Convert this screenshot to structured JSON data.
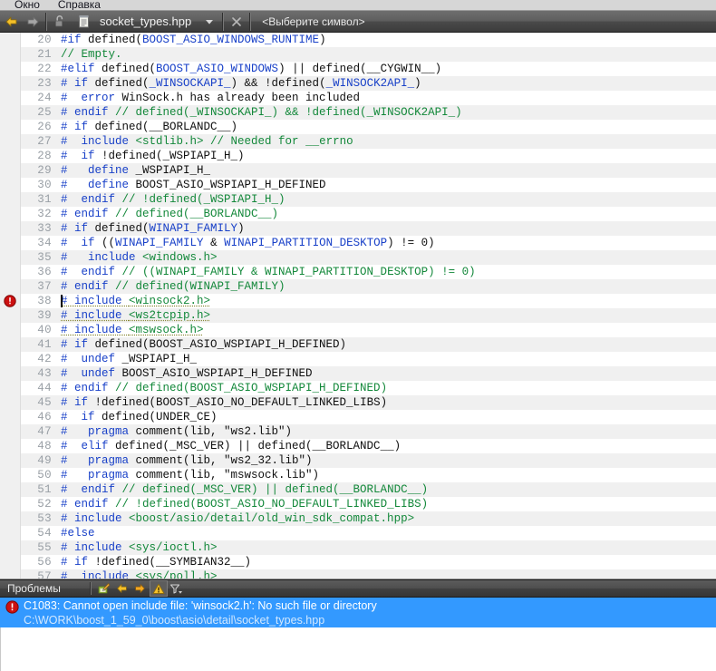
{
  "menubar": {
    "items": [
      {
        "label": "Окно"
      },
      {
        "label": "Справка"
      }
    ]
  },
  "navbar": {
    "back_icon": "back-arrow-icon",
    "forward_icon": "forward-arrow-icon",
    "lock_icon": "unlocked-padlock-icon",
    "file_icon": "document-icon",
    "file_name": "socket_types.hpp",
    "dropdown_icon": "chevron-down-icon",
    "close_icon": "close-icon",
    "symbol_selector": "<Выберите символ>"
  },
  "editor": {
    "cursor_line": 38,
    "error_line": 38,
    "lines": [
      {
        "no": 20,
        "tokens": [
          {
            "t": "#if ",
            "c": "k"
          },
          {
            "t": "defined(",
            "c": "n"
          },
          {
            "t": "BOOST_ASIO_WINDOWS_RUNTIME",
            "c": "k"
          },
          {
            "t": ")",
            "c": "n"
          }
        ]
      },
      {
        "no": 21,
        "tokens": [
          {
            "t": "// Empty.",
            "c": "c"
          }
        ]
      },
      {
        "no": 22,
        "tokens": [
          {
            "t": "#elif ",
            "c": "k"
          },
          {
            "t": "defined(",
            "c": "n"
          },
          {
            "t": "BOOST_ASIO_WINDOWS",
            "c": "k"
          },
          {
            "t": ") || defined(__CYGWIN__)",
            "c": "n"
          }
        ]
      },
      {
        "no": 23,
        "tokens": [
          {
            "t": "# if ",
            "c": "k"
          },
          {
            "t": "defined(",
            "c": "n"
          },
          {
            "t": "_WINSOCKAPI_",
            "c": "k"
          },
          {
            "t": ") && !defined(",
            "c": "n"
          },
          {
            "t": "_WINSOCK2API_",
            "c": "k"
          },
          {
            "t": ")",
            "c": "n"
          }
        ]
      },
      {
        "no": 24,
        "tokens": [
          {
            "t": "#  error ",
            "c": "k"
          },
          {
            "t": "WinSock.h has already been included",
            "c": "n"
          }
        ]
      },
      {
        "no": 25,
        "tokens": [
          {
            "t": "# endif ",
            "c": "k"
          },
          {
            "t": "// defined(_WINSOCKAPI_) && !defined(_WINSOCK2API_)",
            "c": "c"
          }
        ]
      },
      {
        "no": 26,
        "tokens": [
          {
            "t": "# if ",
            "c": "k"
          },
          {
            "t": "defined(__BORLANDC__)",
            "c": "n"
          }
        ]
      },
      {
        "no": 27,
        "tokens": [
          {
            "t": "#  include ",
            "c": "k"
          },
          {
            "t": "<stdlib.h>",
            "c": "c"
          },
          {
            "t": " ",
            "c": "n"
          },
          {
            "t": "// Needed for __errno",
            "c": "c"
          }
        ]
      },
      {
        "no": 28,
        "tokens": [
          {
            "t": "#  if ",
            "c": "k"
          },
          {
            "t": "!defined(_WSPIAPI_H_)",
            "c": "n"
          }
        ]
      },
      {
        "no": 29,
        "tokens": [
          {
            "t": "#   define ",
            "c": "k"
          },
          {
            "t": "_WSPIAPI_H_",
            "c": "n"
          }
        ]
      },
      {
        "no": 30,
        "tokens": [
          {
            "t": "#   define ",
            "c": "k"
          },
          {
            "t": "BOOST_ASIO_WSPIAPI_H_DEFINED",
            "c": "n"
          }
        ]
      },
      {
        "no": 31,
        "tokens": [
          {
            "t": "#  endif ",
            "c": "k"
          },
          {
            "t": "// !defined(_WSPIAPI_H_)",
            "c": "c"
          }
        ]
      },
      {
        "no": 32,
        "tokens": [
          {
            "t": "# endif ",
            "c": "k"
          },
          {
            "t": "// defined(__BORLANDC__)",
            "c": "c"
          }
        ]
      },
      {
        "no": 33,
        "tokens": [
          {
            "t": "# if ",
            "c": "k"
          },
          {
            "t": "defined(",
            "c": "n"
          },
          {
            "t": "WINAPI_FAMILY",
            "c": "k"
          },
          {
            "t": ")",
            "c": "n"
          }
        ]
      },
      {
        "no": 34,
        "tokens": [
          {
            "t": "#  if ",
            "c": "k"
          },
          {
            "t": "((",
            "c": "n"
          },
          {
            "t": "WINAPI_FAMILY",
            "c": "k"
          },
          {
            "t": " & ",
            "c": "n"
          },
          {
            "t": "WINAPI_PARTITION_DESKTOP",
            "c": "k"
          },
          {
            "t": ") != 0)",
            "c": "n"
          }
        ]
      },
      {
        "no": 35,
        "tokens": [
          {
            "t": "#   include ",
            "c": "k"
          },
          {
            "t": "<windows.h>",
            "c": "c"
          }
        ]
      },
      {
        "no": 36,
        "tokens": [
          {
            "t": "#  endif ",
            "c": "k"
          },
          {
            "t": "// ((WINAPI_FAMILY & WINAPI_PARTITION_DESKTOP) != 0)",
            "c": "c"
          }
        ]
      },
      {
        "no": 37,
        "tokens": [
          {
            "t": "# endif ",
            "c": "k"
          },
          {
            "t": "// defined(WINAPI_FAMILY)",
            "c": "c"
          }
        ]
      },
      {
        "no": 38,
        "squiggle": true,
        "tokens": [
          {
            "t": "# include ",
            "c": "k"
          },
          {
            "t": "<winsock2.h>",
            "c": "c"
          }
        ]
      },
      {
        "no": 39,
        "squiggle": true,
        "tokens": [
          {
            "t": "# include ",
            "c": "k"
          },
          {
            "t": "<ws2tcpip.h>",
            "c": "c"
          }
        ]
      },
      {
        "no": 40,
        "squiggle": true,
        "tokens": [
          {
            "t": "# include ",
            "c": "k"
          },
          {
            "t": "<mswsock.h>",
            "c": "c"
          }
        ]
      },
      {
        "no": 41,
        "tokens": [
          {
            "t": "# if ",
            "c": "k"
          },
          {
            "t": "defined(BOOST_ASIO_WSPIAPI_H_DEFINED)",
            "c": "n"
          }
        ]
      },
      {
        "no": 42,
        "tokens": [
          {
            "t": "#  undef ",
            "c": "k"
          },
          {
            "t": "_WSPIAPI_H_",
            "c": "n"
          }
        ]
      },
      {
        "no": 43,
        "tokens": [
          {
            "t": "#  undef ",
            "c": "k"
          },
          {
            "t": "BOOST_ASIO_WSPIAPI_H_DEFINED",
            "c": "n"
          }
        ]
      },
      {
        "no": 44,
        "tokens": [
          {
            "t": "# endif ",
            "c": "k"
          },
          {
            "t": "// defined(BOOST_ASIO_WSPIAPI_H_DEFINED)",
            "c": "c"
          }
        ]
      },
      {
        "no": 45,
        "tokens": [
          {
            "t": "# if ",
            "c": "k"
          },
          {
            "t": "!defined(BOOST_ASIO_NO_DEFAULT_LINKED_LIBS)",
            "c": "n"
          }
        ]
      },
      {
        "no": 46,
        "tokens": [
          {
            "t": "#  if ",
            "c": "k"
          },
          {
            "t": "defined(UNDER_CE)",
            "c": "n"
          }
        ]
      },
      {
        "no": 47,
        "tokens": [
          {
            "t": "#   pragma ",
            "c": "k"
          },
          {
            "t": "comment(lib, \"ws2.lib\")",
            "c": "n"
          }
        ]
      },
      {
        "no": 48,
        "tokens": [
          {
            "t": "#  elif ",
            "c": "k"
          },
          {
            "t": "defined(_MSC_VER) || defined(__BORLANDC__)",
            "c": "n"
          }
        ]
      },
      {
        "no": 49,
        "tokens": [
          {
            "t": "#   pragma ",
            "c": "k"
          },
          {
            "t": "comment(lib, \"ws2_32.lib\")",
            "c": "n"
          }
        ]
      },
      {
        "no": 50,
        "tokens": [
          {
            "t": "#   pragma ",
            "c": "k"
          },
          {
            "t": "comment(lib, \"mswsock.lib\")",
            "c": "n"
          }
        ]
      },
      {
        "no": 51,
        "tokens": [
          {
            "t": "#  endif ",
            "c": "k"
          },
          {
            "t": "// defined(_MSC_VER) || defined(__BORLANDC__)",
            "c": "c"
          }
        ]
      },
      {
        "no": 52,
        "tokens": [
          {
            "t": "# endif ",
            "c": "k"
          },
          {
            "t": "// !defined(BOOST_ASIO_NO_DEFAULT_LINKED_LIBS)",
            "c": "c"
          }
        ]
      },
      {
        "no": 53,
        "tokens": [
          {
            "t": "# include ",
            "c": "k"
          },
          {
            "t": "<boost/asio/detail/old_win_sdk_compat.hpp>",
            "c": "c"
          }
        ]
      },
      {
        "no": 54,
        "tokens": [
          {
            "t": "#else",
            "c": "k"
          }
        ]
      },
      {
        "no": 55,
        "tokens": [
          {
            "t": "# include ",
            "c": "k"
          },
          {
            "t": "<sys/ioctl.h>",
            "c": "c"
          }
        ]
      },
      {
        "no": 56,
        "tokens": [
          {
            "t": "# if ",
            "c": "k"
          },
          {
            "t": "!defined(__SYMBIAN32__)",
            "c": "n"
          }
        ]
      },
      {
        "no": 57,
        "tokens": [
          {
            "t": "#  include ",
            "c": "k"
          },
          {
            "t": "<sys/poll.h>",
            "c": "c"
          }
        ]
      }
    ]
  },
  "problems_panel": {
    "title": "Проблемы",
    "tools": [
      {
        "name": "edit-pencil-icon",
        "active": false
      },
      {
        "name": "previous-arrow-icon",
        "active": false
      },
      {
        "name": "next-arrow-icon",
        "active": false
      },
      {
        "name": "warning-triangle-icon",
        "active": true
      },
      {
        "name": "filter-funnel-icon",
        "active": false
      }
    ],
    "rows": [
      {
        "icon": "error-icon",
        "message": "C1083: Cannot open include file: 'winsock2.h': No such file or directory",
        "path": "C:\\WORK\\boost_1_59_0\\boost\\asio\\detail\\socket_types.hpp",
        "selected": true
      }
    ]
  },
  "colors": {
    "preprocessor_blue": "#1840c8",
    "comment_green": "#13883a",
    "selection_blue": "#3399ff",
    "error_red": "#cc1111",
    "toolbar_dark": "#4a4a4a",
    "alt_row": "#f0f0f0"
  }
}
